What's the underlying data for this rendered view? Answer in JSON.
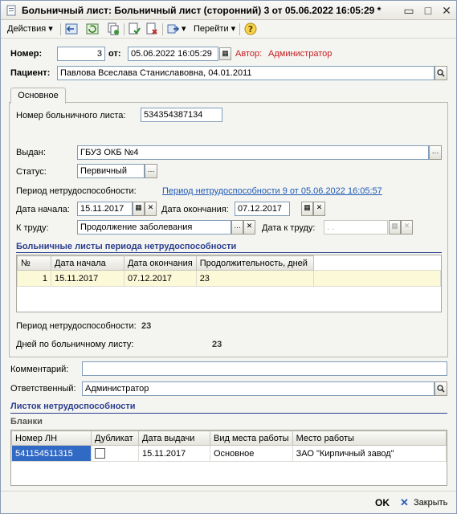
{
  "window": {
    "title": "Больничный лист: Больничный лист (сторонний) 3 от 05.06.2022 16:05:29 *"
  },
  "toolbar": {
    "actions_label": "Действия",
    "goto_label": "Перейти"
  },
  "header": {
    "number_label": "Номер:",
    "number_value": "3",
    "from_label": "от:",
    "date_value": "05.06.2022 16:05:29",
    "author_label": "Автор:",
    "author_value": "Администратор",
    "patient_label": "Пациент:",
    "patient_value": "Павлова Всеслава Станиславовна, 04.01.2011"
  },
  "tabs": [
    "Основное"
  ],
  "main": {
    "sick_list_number_label": "Номер больничного листа:",
    "sick_list_number_value": "534354387134",
    "issued_label": "Выдан:",
    "issued_value": "ГБУЗ ОКБ №4",
    "status_label": "Статус:",
    "status_value": "Первичный",
    "period_label": "Период нетрудоспособности:",
    "period_link": "Период нетрудоспособности 9 от 05.06.2022 16:05:57",
    "start_label": "Дата начала:",
    "start_value": "15.11.2017",
    "end_label": "Дата окончания:",
    "end_value": "07.12.2017",
    "work_label": "К труду:",
    "work_value": "Продолжение заболевания",
    "work_date_label": "Дата к труду:",
    "work_date_value": ". .",
    "period_lists_title": "Больничные листы периода нетрудоспособности",
    "period_table": {
      "columns": [
        "№",
        "Дата начала",
        "Дата окончания",
        "Продолжительность, дней"
      ],
      "rows": [
        [
          "1",
          "15.11.2017",
          "07.12.2017",
          "23"
        ]
      ]
    },
    "period_total_label": "Период нетрудоспособности:",
    "period_total_value": "23",
    "days_label": "Дней по больничному листу:",
    "days_value": "23"
  },
  "comment_label": "Комментарий:",
  "comment_value": "",
  "responsible_label": "Ответственный:",
  "responsible_value": "Администратор",
  "sheet_title": "Листок нетрудоспособности",
  "blanks_title": "Бланки",
  "blanks_table": {
    "columns": [
      "Номер ЛН",
      "Дубликат",
      "Дата выдачи",
      "Вид места работы",
      "Место работы"
    ],
    "rows": [
      [
        "541154511315",
        "",
        "15.11.2017",
        "Основное",
        "ЗАО \"Кирпичный завод\""
      ]
    ]
  },
  "footer": {
    "ok_label": "OK",
    "close_label": "Закрыть"
  },
  "colors": {
    "accent": "#2c3f8f",
    "link": "#1f5bb5",
    "author": "#c41e1e",
    "selected_row": "#fbf9d8",
    "selected_cell": "#316ac5"
  }
}
